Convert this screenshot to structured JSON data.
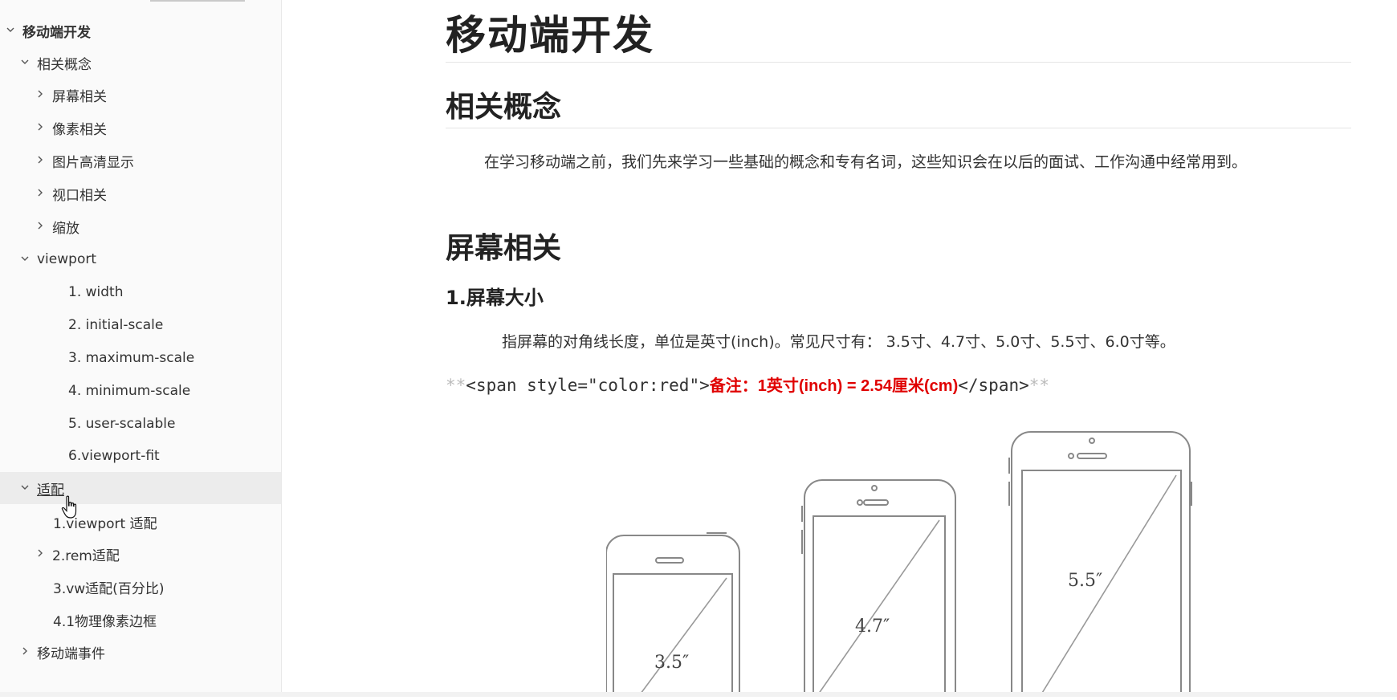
{
  "sidebar": {
    "items": [
      {
        "label": "移动端开发",
        "chevron": "down"
      },
      {
        "label": "相关概念",
        "chevron": "down"
      },
      {
        "label": "屏幕相关",
        "chevron": "right"
      },
      {
        "label": "像素相关",
        "chevron": "right"
      },
      {
        "label": "图片高清显示",
        "chevron": "right"
      },
      {
        "label": "视口相关",
        "chevron": "right"
      },
      {
        "label": "缩放",
        "chevron": "right"
      },
      {
        "label": "viewport",
        "chevron": "down"
      },
      {
        "label": "1. width",
        "chevron": "none"
      },
      {
        "label": "2. initial-scale",
        "chevron": "none"
      },
      {
        "label": "3. maximum-scale",
        "chevron": "none"
      },
      {
        "label": "4. minimum-scale",
        "chevron": "none"
      },
      {
        "label": "5. user-scalable",
        "chevron": "none"
      },
      {
        "label": "6.viewport-fit",
        "chevron": "none"
      },
      {
        "label": "适配",
        "chevron": "down",
        "active": true
      },
      {
        "label": "1.viewport 适配",
        "chevron": "none"
      },
      {
        "label": "2.rem适配",
        "chevron": "right"
      },
      {
        "label": "3.vw适配(百分比)",
        "chevron": "none"
      },
      {
        "label": "4.1物理像素边框",
        "chevron": "none"
      },
      {
        "label": "移动端事件",
        "chevron": "right"
      }
    ]
  },
  "main": {
    "title": "移动端开发",
    "section_concepts": "相关概念",
    "intro": "在学习移动端之前，我们先来学习一些基础的概念和专有名词，这些知识会在以后的面试、工作沟通中经常用到。",
    "section_screen": "屏幕相关",
    "screen_size_heading": "1.屏幕大小",
    "screen_size_desc": "指屏幕的对角线长度，单位是英寸(inch)。常见尺寸有： 3.5寸、4.7寸、5.0寸、5.5寸、6.0寸等。",
    "note": {
      "prefix_stars": "**",
      "open_tag": "<span style=\"color:red\">",
      "red_text": "备注：1英寸(inch) = 2.54厘米(cm)",
      "close_tag": "</span>",
      "suffix_stars": "**"
    },
    "phones": [
      "3.5″",
      "4.7″",
      "5.5″"
    ]
  }
}
